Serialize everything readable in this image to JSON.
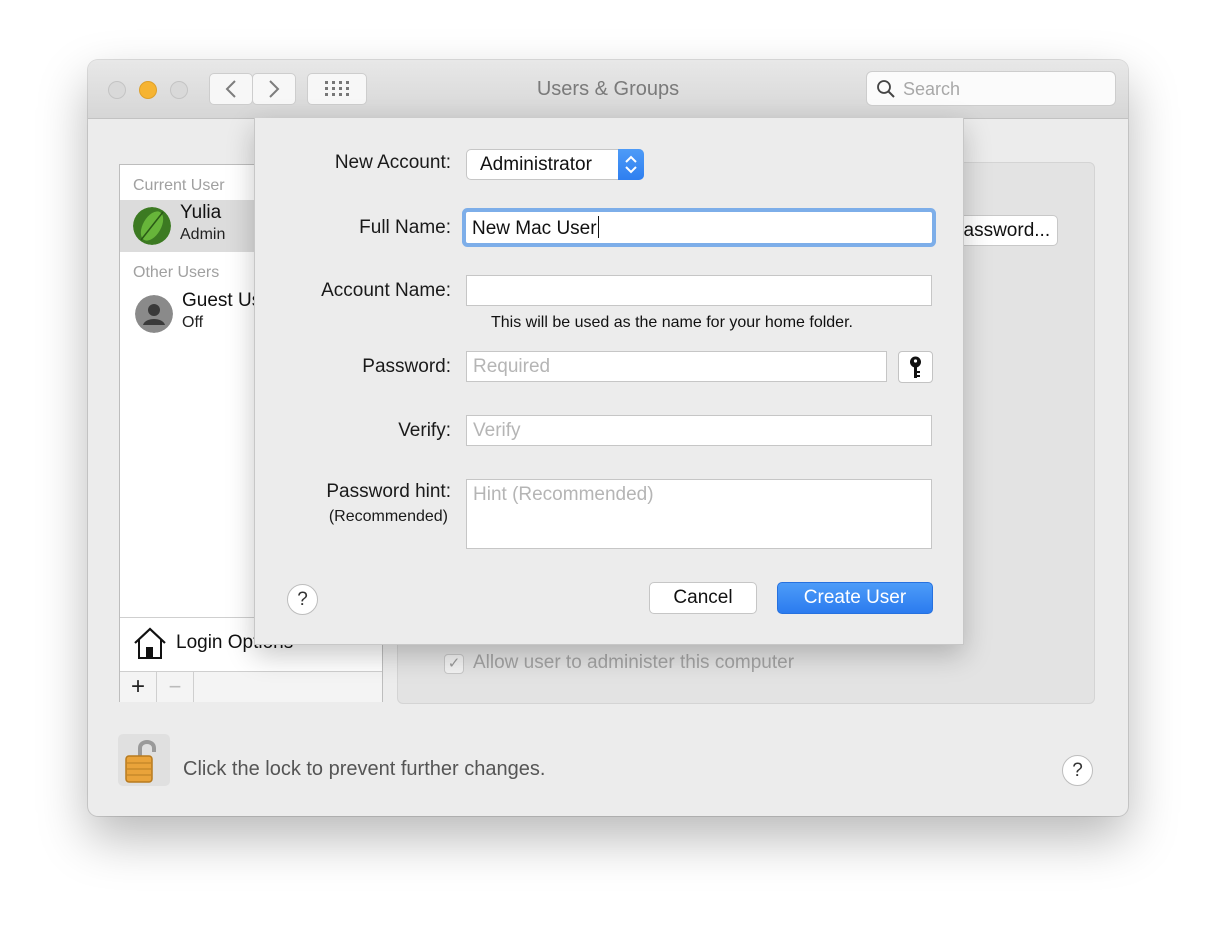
{
  "window": {
    "title": "Users & Groups"
  },
  "toolbar": {
    "search_placeholder": "Search"
  },
  "sidebar": {
    "current_user_heading": "Current User",
    "current_user": {
      "name": "Yulia",
      "role": "Admin"
    },
    "other_users_heading": "Other Users",
    "other_user": {
      "name": "Guest User",
      "status": "Off"
    },
    "login_options_label": "Login Options",
    "add_symbol": "+",
    "remove_symbol": "−"
  },
  "background": {
    "password_button_label": "Change Password...",
    "allow_admin_label": "Allow user to administer this computer",
    "allow_admin_checked": true,
    "lock_text": "Click the lock to prevent further changes."
  },
  "sheet": {
    "new_account_label": "New Account:",
    "new_account_value": "Administrator",
    "full_name_label": "Full Name:",
    "full_name_value": "New Mac User",
    "account_name_label": "Account Name:",
    "account_name_value": "",
    "account_name_note": "This will be used as the name for your home folder.",
    "password_label": "Password:",
    "password_placeholder": "Required",
    "verify_label": "Verify:",
    "verify_placeholder": "Verify",
    "hint_label": "Password hint:",
    "hint_sublabel": "(Recommended)",
    "hint_placeholder": "Hint (Recommended)",
    "cancel_label": "Cancel",
    "create_label": "Create User",
    "help_symbol": "?"
  },
  "colors": {
    "accent": "#2f7ff0",
    "focus_ring": "#7daee9",
    "minimize": "#f6b432"
  }
}
